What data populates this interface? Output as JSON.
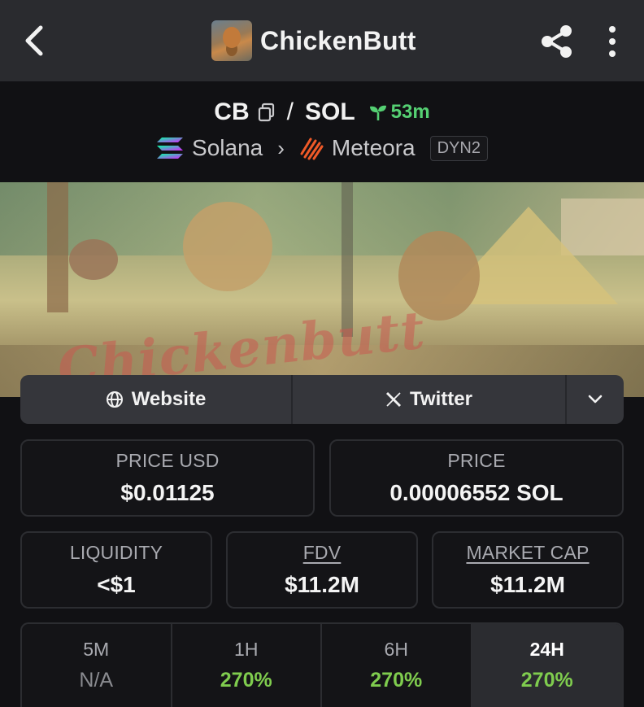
{
  "header": {
    "title": "ChickenButt",
    "back_icon": "chevron-left-icon",
    "share_icon": "share-icon",
    "more_icon": "more-vertical-icon"
  },
  "pair": {
    "base": "CB",
    "separator": "/",
    "quote": "SOL",
    "age": "53m",
    "age_color": "#55d073",
    "chain": "Solana",
    "dex": "Meteora",
    "dex_tag": "DYN2"
  },
  "banner": {
    "text": "Chickenbutt"
  },
  "links": {
    "website": "Website",
    "twitter": "Twitter"
  },
  "stats": {
    "price_usd": {
      "label": "PRICE USD",
      "value": "$0.01125"
    },
    "price": {
      "label": "PRICE",
      "value": "0.00006552 SOL"
    },
    "liquidity": {
      "label": "LIQUIDITY",
      "value": "<$1"
    },
    "fdv": {
      "label": "FDV",
      "value": "$11.2M"
    },
    "market_cap": {
      "label": "MARKET CAP",
      "value": "$11.2M"
    }
  },
  "timeframes": [
    {
      "label": "5M",
      "value": "N/A"
    },
    {
      "label": "1H",
      "value": "270%"
    },
    {
      "label": "6H",
      "value": "270%"
    },
    {
      "label": "24H",
      "value": "270%"
    }
  ],
  "colors": {
    "positive": "#7fcc4e",
    "background": "#111114",
    "appbar": "#2a2b2f"
  }
}
